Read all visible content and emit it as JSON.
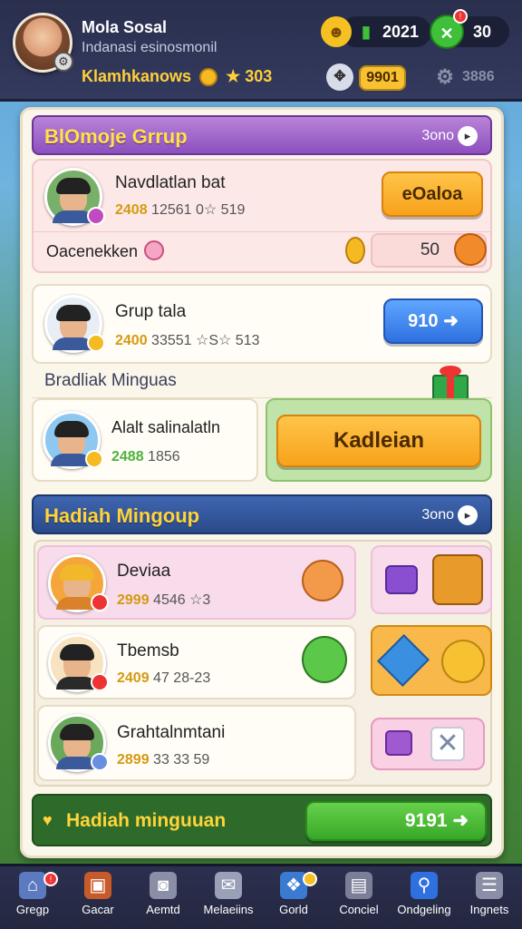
{
  "profile": {
    "name": "Mola Sosal",
    "subtitle": "Indanasi esinosmonil",
    "stat_label": "Klamhkanows",
    "stat_value": "★ 303"
  },
  "resources": {
    "r1": "2021",
    "r2": "30",
    "r3": "9901",
    "r4": "3886"
  },
  "group_section": {
    "title": "BlOmoje Grrup",
    "more": "3ono",
    "card1": {
      "name": "Navdlatlan bat",
      "stats_hl": "2408",
      "stats": "12561 0☆ 519",
      "button": "eOaloa",
      "footer_label": "Oacenekken",
      "footer_value": "50"
    },
    "card2": {
      "name": "Grup tala",
      "stats_hl": "2400",
      "stats": "33551 ☆S☆ 513",
      "button": "910 ➜"
    },
    "sub_label": "Bradliak Minguas",
    "card3": {
      "name": "Alalt salinalatln",
      "stats_hl": "2488",
      "stats": "1856",
      "button": "Kadleian"
    }
  },
  "weekly_section": {
    "title": "Hadiah Mingoup",
    "more": "3ono",
    "rows": [
      {
        "name": "Deviaa",
        "stats_hl": "2999",
        "stats": "4546 ☆3"
      },
      {
        "name": "Tbemsb",
        "stats_hl": "2409",
        "stats": "47 28-23"
      },
      {
        "name": "Grahtalnmtani",
        "stats_hl": "2899",
        "stats": "33 33 59"
      }
    ]
  },
  "claim_bar": {
    "label": "Hadiah minguuan",
    "button": "9191 ➜"
  },
  "nav": [
    {
      "label": "Gregp",
      "icon": "home-icon"
    },
    {
      "label": "Gacar",
      "icon": "box-icon"
    },
    {
      "label": "Aemtd",
      "icon": "bag-icon"
    },
    {
      "label": "Melaeiins",
      "icon": "mail-icon"
    },
    {
      "label": "Gorld",
      "icon": "gift-icon"
    },
    {
      "label": "Conciel",
      "icon": "chest-icon"
    },
    {
      "label": "Ondgeling",
      "icon": "search-icon"
    },
    {
      "label": "Ingnets",
      "icon": "list-icon"
    }
  ],
  "colors": {
    "topbar": "#2a2f4e",
    "panel": "#fbf6ea",
    "accent_orange": "#f7a21a",
    "accent_blue": "#2e70e0",
    "accent_green": "#38a829",
    "group_header": "#9b5bc2",
    "weekly_header": "#2f4f8f"
  }
}
